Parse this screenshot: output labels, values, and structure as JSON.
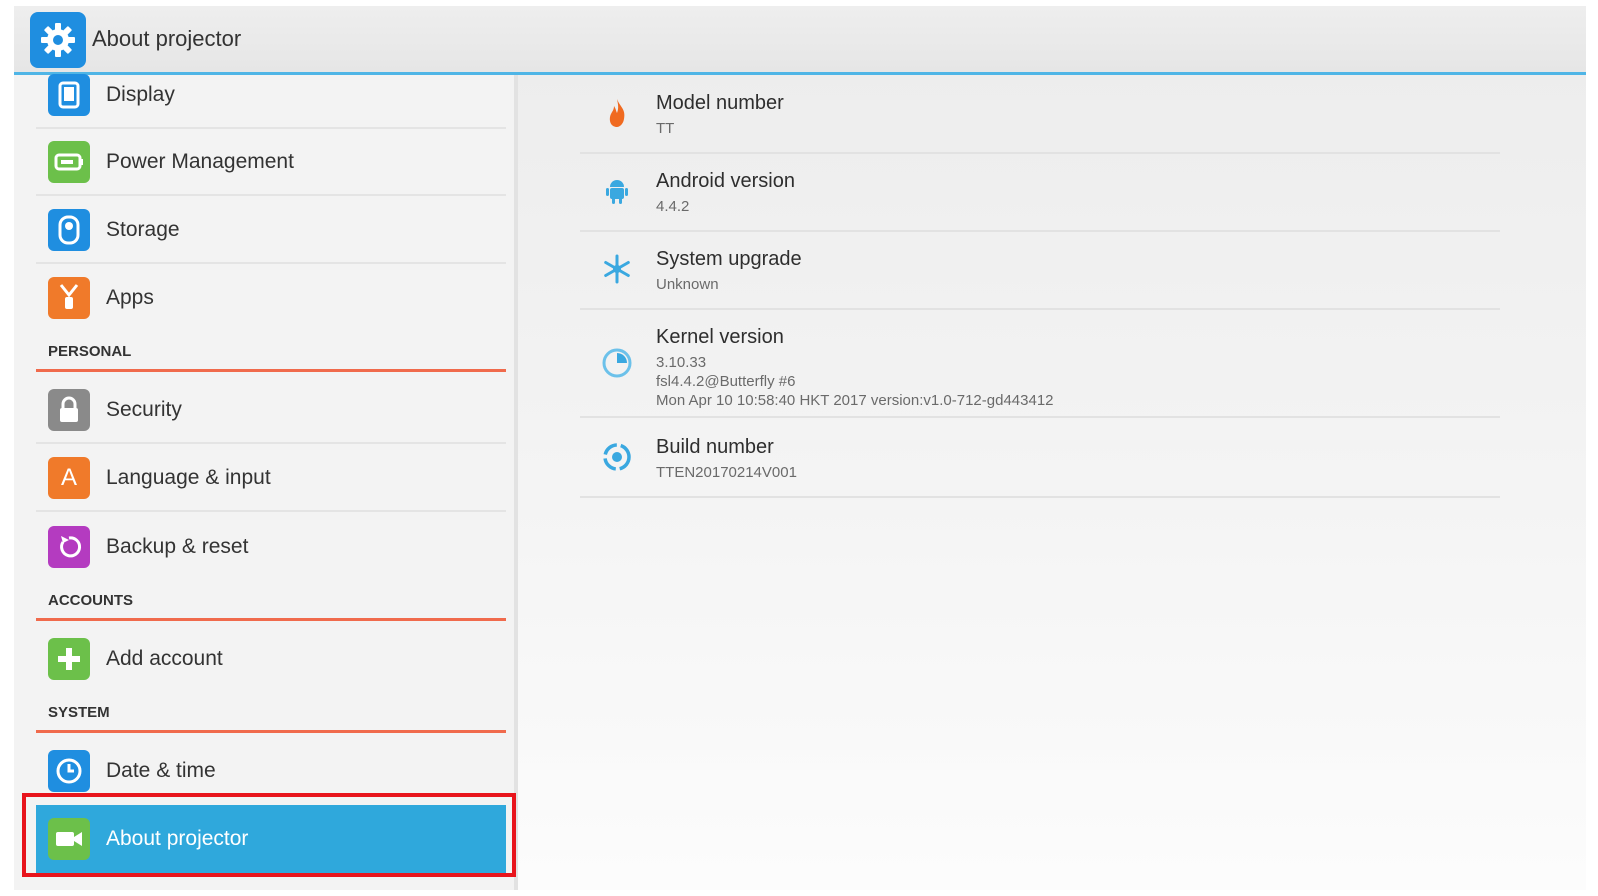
{
  "header": {
    "title": "About projector",
    "icon": "gear-icon"
  },
  "sidebar": {
    "items": [
      {
        "label": "Display",
        "icon": "display-icon",
        "color": "#1f8ee0"
      },
      {
        "label": "Power Management",
        "icon": "battery-icon",
        "color": "#6cc04a"
      },
      {
        "label": "Storage",
        "icon": "storage-icon",
        "color": "#1f8ee0"
      },
      {
        "label": "Apps",
        "icon": "apps-icon",
        "color": "#f07a2a"
      }
    ],
    "personal": {
      "header": "PERSONAL",
      "items": [
        {
          "label": "Security",
          "icon": "lock-icon",
          "color": "#8a8a8a"
        },
        {
          "label": "Language & input",
          "icon": "language-icon",
          "color": "#f07a2a",
          "glyph": "A"
        },
        {
          "label": "Backup & reset",
          "icon": "backup-icon",
          "color": "#b43bc0"
        }
      ]
    },
    "accounts": {
      "header": "ACCOUNTS",
      "items": [
        {
          "label": "Add account",
          "icon": "plus-icon",
          "color": "#6cc04a"
        }
      ]
    },
    "system": {
      "header": "SYSTEM",
      "items": [
        {
          "label": "Date & time",
          "icon": "clock-icon",
          "color": "#1f8ee0"
        },
        {
          "label": "About projector",
          "icon": "projector-icon",
          "color": "#6cc04a",
          "selected": true
        }
      ]
    }
  },
  "details": [
    {
      "title": "Model number",
      "values": [
        "TT"
      ],
      "icon": "flame-icon",
      "color": "#f06a20"
    },
    {
      "title": "Android version",
      "values": [
        "4.4.2"
      ],
      "icon": "android-icon",
      "color": "#3aa8e0"
    },
    {
      "title": "System upgrade",
      "values": [
        "Unknown"
      ],
      "icon": "snowflake-icon",
      "color": "#3aa8e0"
    },
    {
      "title": "Kernel version",
      "values": [
        "3.10.33",
        "fsl4.4.2@Butterfly #6",
        "Mon Apr 10 10:58:40 HKT 2017 version:v1.0-712-gd443412"
      ],
      "icon": "pie-icon",
      "color": "#3aa8e0"
    },
    {
      "title": "Build number",
      "values": [
        "TTEN20170214V001"
      ],
      "icon": "build-icon",
      "color": "#3aa8e0"
    }
  ],
  "colors": {
    "accent": "#2fa8dc",
    "section_line": "#f06a4c",
    "highlight": "#e8141c"
  }
}
